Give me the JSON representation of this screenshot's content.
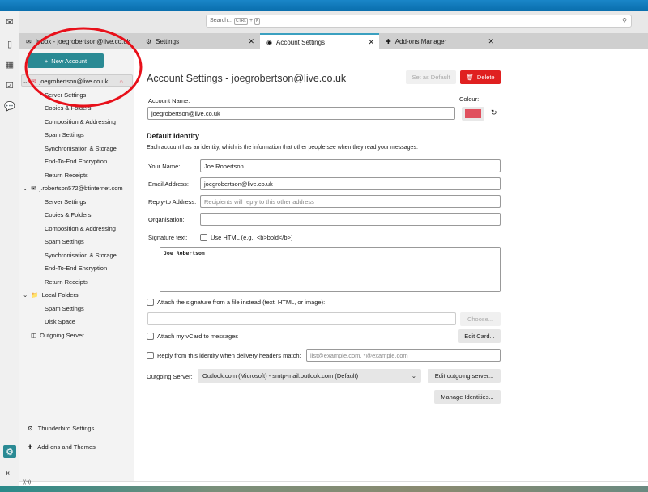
{
  "toolbar": {
    "search_placeholder": "Search...",
    "kbd1": "CTRL",
    "plus": "+",
    "kbd2": "K"
  },
  "tabs": [
    {
      "label": "Inbox - joegrobertson@live.co.uk"
    },
    {
      "label": "Settings"
    },
    {
      "label": "Account Settings"
    },
    {
      "label": "Add-ons Manager"
    }
  ],
  "sidebar": {
    "new_account": "New Account",
    "accounts": [
      {
        "name": "joegrobertson@live.co.uk",
        "items": [
          "Server Settings",
          "Copies & Folders",
          "Composition & Addressing",
          "Spam Settings",
          "Synchronisation & Storage",
          "End-To-End Encryption",
          "Return Receipts"
        ]
      },
      {
        "name": "j.robertson572@btinternet.com",
        "items": [
          "Server Settings",
          "Copies & Folders",
          "Composition & Addressing",
          "Spam Settings",
          "Synchronisation & Storage",
          "End-To-End Encryption",
          "Return Receipts"
        ]
      },
      {
        "name": "Local Folders",
        "items": [
          "Spam Settings",
          "Disk Space"
        ]
      }
    ],
    "outgoing_server": "Outgoing Server",
    "thunderbird_settings": "Thunderbird Settings",
    "addons_themes": "Add-ons and Themes"
  },
  "main": {
    "title": "Account Settings - joegrobertson@live.co.uk",
    "set_default": "Set as Default",
    "delete": "Delete",
    "account_name_label": "Account Name:",
    "account_name": "joegrobertson@live.co.uk",
    "colour_label": "Colour:",
    "colour": "#e0505e",
    "default_identity": "Default Identity",
    "identity_desc": "Each account has an identity, which is the information that other people see when they read your messages.",
    "your_name_label": "Your Name:",
    "your_name": "Joe Robertson",
    "email_label": "Email Address:",
    "email": "joegrobertson@live.co.uk",
    "replyto_label": "Reply-to Address:",
    "replyto_placeholder": "Recipients will reply to this other address",
    "org_label": "Organisation:",
    "org": "",
    "signature_label": "Signature text:",
    "use_html": "Use HTML (e.g., <b>bold</b>)",
    "signature": "Joe Robertson",
    "attach_sig": "Attach the signature from a file instead (text, HTML, or image):",
    "choose": "Choose...",
    "attach_vcard": "Attach my vCard to messages",
    "edit_card": "Edit Card...",
    "reply_from": "Reply from this identity when delivery headers match:",
    "reply_from_placeholder": "list@example.com, *@example.com",
    "outgoing_label": "Outgoing Server:",
    "outgoing_value": "Outlook.com (Microsoft) - smtp-mail.outlook.com (Default)",
    "edit_outgoing": "Edit outgoing server...",
    "manage_identities": "Manage Identities..."
  }
}
